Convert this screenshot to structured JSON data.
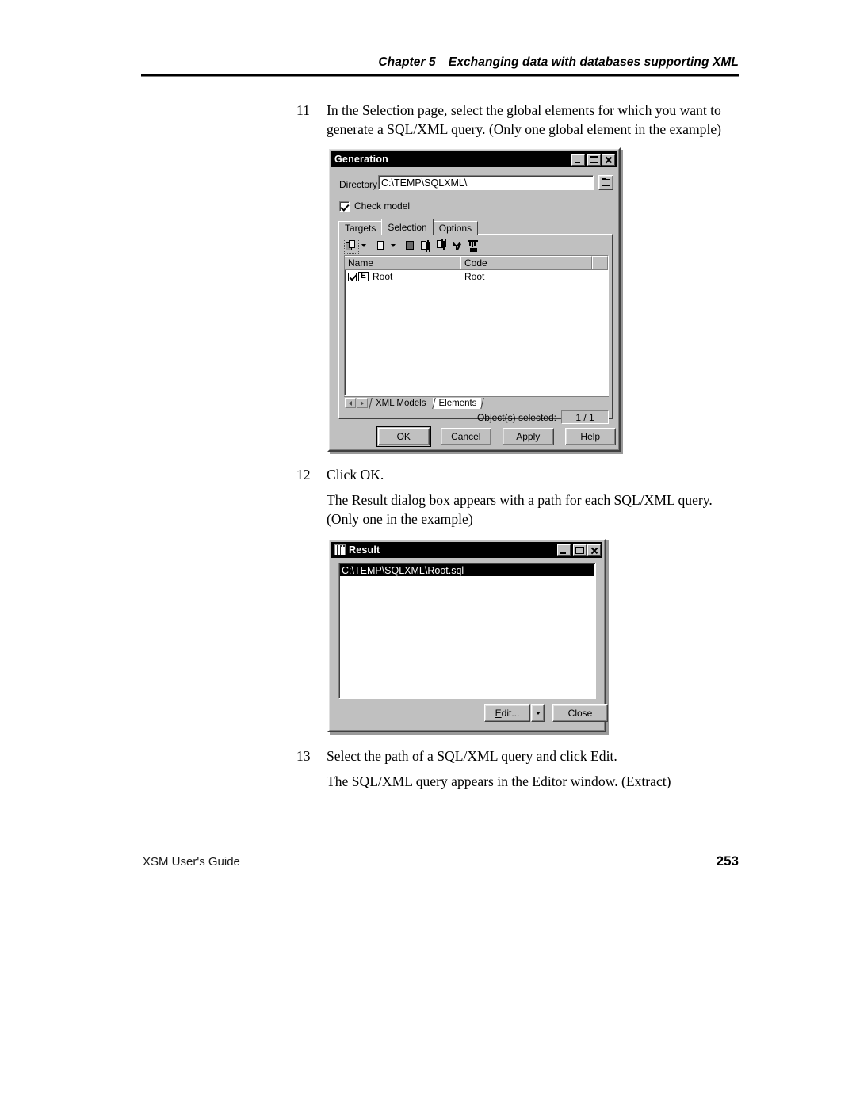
{
  "page": {
    "running_head_chapter": "Chapter 5",
    "running_head_title": "Exchanging data with databases supporting XML",
    "footer_left": "XSM User's Guide",
    "footer_page_number": "253"
  },
  "steps": {
    "step11": {
      "number": "11",
      "text": "In the Selection page, select the global elements for which you want to generate a SQL/XML query. (Only one global element in the example)"
    },
    "step12": {
      "number": "12",
      "text": "Click OK.",
      "follow_up": "The Result dialog box appears with a path for each SQL/XML query. (Only one in the example)"
    },
    "step13": {
      "number": "13",
      "text": "Select the path of a SQL/XML query and click Edit.",
      "follow_up": "The SQL/XML query appears in the Editor window. (Extract)"
    }
  },
  "generation_dialog": {
    "title": "Generation",
    "directory_label": "Directory:",
    "directory_value": "C:\\TEMP\\SQLXML\\",
    "browse_icon": "folder-icon",
    "check_model_label": "Check model",
    "check_model_checked": true,
    "tabs": [
      {
        "label": "Targets",
        "active": false
      },
      {
        "label": "Selection",
        "active": true
      },
      {
        "label": "Options",
        "active": false
      }
    ],
    "toolbar": [
      {
        "name": "select-all-icon"
      },
      {
        "name": "select-all-dropdown-arrow"
      },
      {
        "name": "deselect-all-icon"
      },
      {
        "name": "deselect-all-dropdown-arrow"
      },
      {
        "name": "invert-selection-icon"
      },
      {
        "name": "move-up-icon"
      },
      {
        "name": "move-down-icon"
      },
      {
        "name": "edit-filter-icon"
      },
      {
        "name": "remove-filter-icon"
      }
    ],
    "list": {
      "columns": [
        "Name",
        "Code"
      ],
      "rows": [
        {
          "checked": true,
          "badge": "E",
          "name": "Root",
          "code": "Root"
        }
      ]
    },
    "sheet_tabs": [
      {
        "label": "XML Models",
        "active": false
      },
      {
        "label": "Elements",
        "active": true
      }
    ],
    "status_label": "Object(s) selected:",
    "status_value": "1 / 1",
    "buttons": [
      {
        "label": "OK",
        "default": true
      },
      {
        "label": "Cancel",
        "default": false
      },
      {
        "label": "Apply",
        "default": false
      },
      {
        "label": "Help",
        "default": false
      }
    ],
    "window_controls": [
      "minimize",
      "maximize",
      "close"
    ]
  },
  "result_dialog": {
    "title": "Result",
    "path_value": "C:\\TEMP\\SQLXML\\Root.sql",
    "path_selected": true,
    "buttons": {
      "edit_label": "Edit...",
      "edit_accelerator": "E",
      "dropdown_icon": "chevron-down-icon",
      "close_label": "Close"
    },
    "window_controls": [
      "minimize",
      "maximize",
      "close"
    ]
  }
}
